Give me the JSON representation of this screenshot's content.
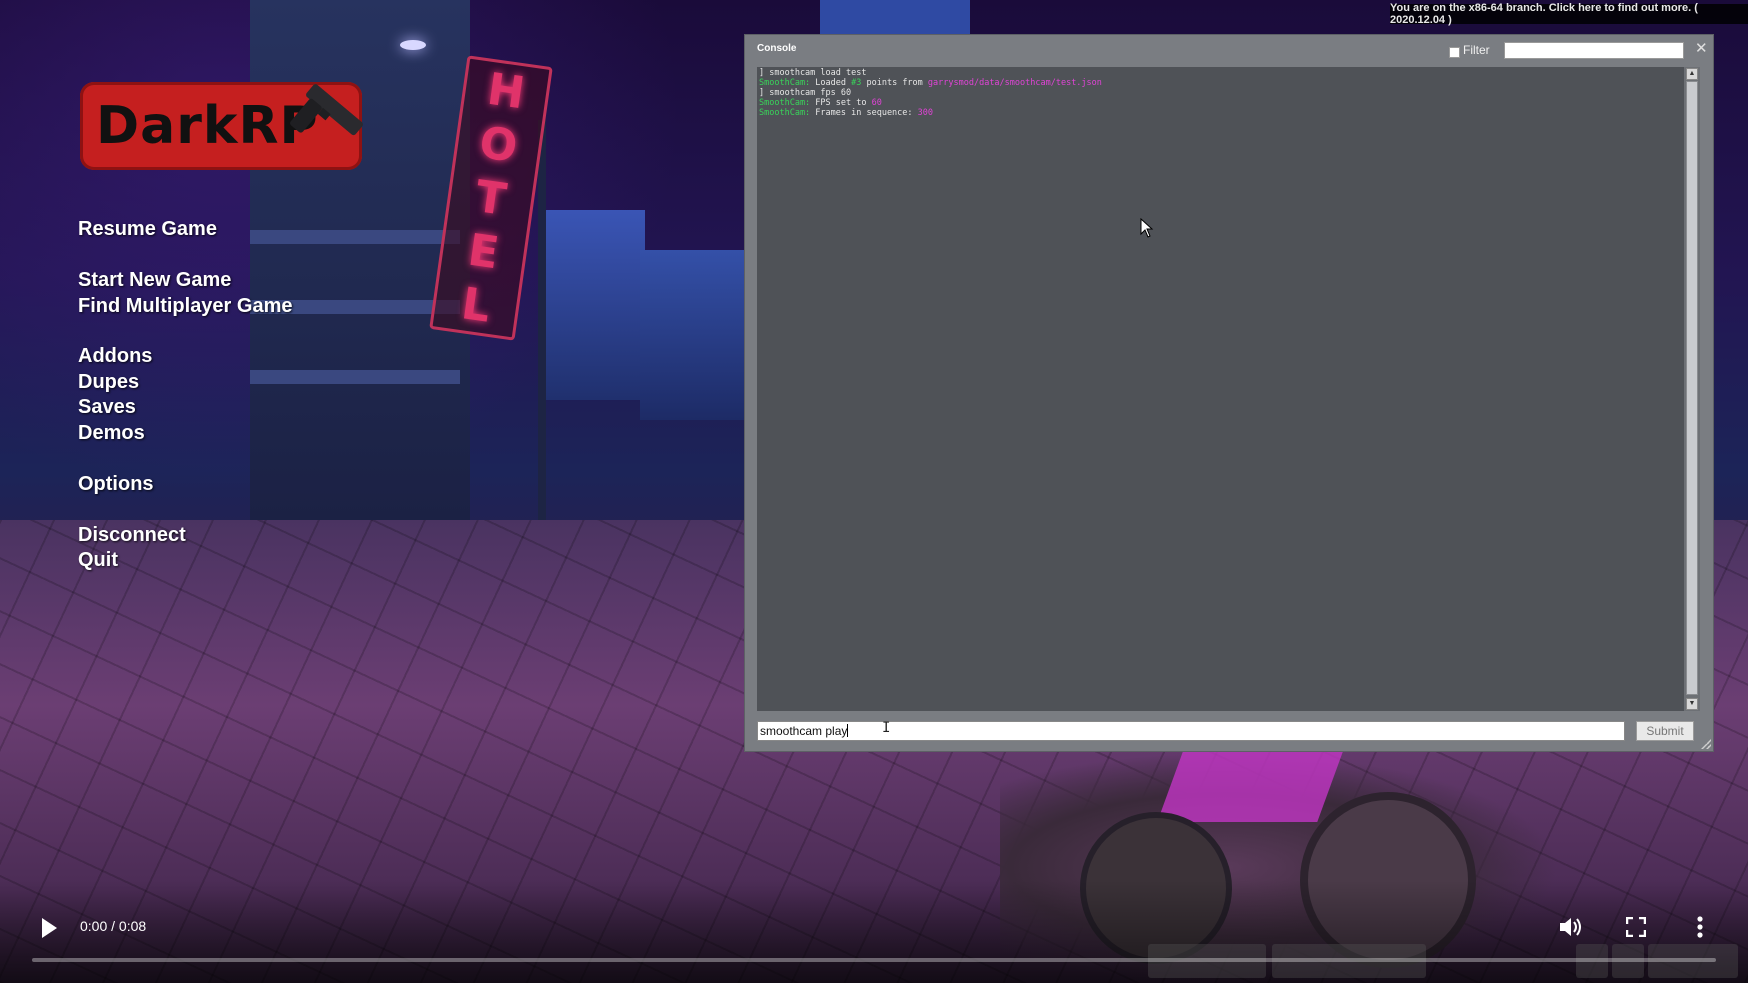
{
  "menu": {
    "logo_text": "DarkRP",
    "items": [
      {
        "label": "Resume Game"
      },
      {
        "label": "Start New Game"
      },
      {
        "label": "Find Multiplayer Game"
      },
      {
        "label": "Addons"
      },
      {
        "label": "Dupes"
      },
      {
        "label": "Saves"
      },
      {
        "label": "Demos"
      },
      {
        "label": "Options"
      },
      {
        "label": "Disconnect"
      },
      {
        "label": "Quit"
      }
    ]
  },
  "banner": {
    "text": "You are on the x86-64 branch. Click here to find out more. ( 2020.12.04 )"
  },
  "console": {
    "title": "Console",
    "filter_label": "Filter",
    "filter_value": "",
    "close_glyph": "✕",
    "input_value": "smoothcam play",
    "submit_label": "Submit",
    "lines": [
      [
        {
          "t": "] smoothcam load test",
          "c": "white"
        }
      ],
      [
        {
          "t": "SmoothCam: ",
          "c": "green"
        },
        {
          "t": "Loaded ",
          "c": "white"
        },
        {
          "t": "#3",
          "c": "green"
        },
        {
          "t": " points from ",
          "c": "white"
        },
        {
          "t": "garrysmod/data/smoothcam/test.json",
          "c": "pink"
        }
      ],
      [
        {
          "t": "] smoothcam fps 60",
          "c": "white"
        }
      ],
      [
        {
          "t": "SmoothCam: ",
          "c": "green"
        },
        {
          "t": "FPS set to ",
          "c": "white"
        },
        {
          "t": "60",
          "c": "pink"
        }
      ],
      [
        {
          "t": "SmoothCam: ",
          "c": "green"
        },
        {
          "t": "Frames in sequence: ",
          "c": "white"
        },
        {
          "t": "300",
          "c": "pink"
        }
      ]
    ]
  },
  "player": {
    "time": "0:00 / 0:08",
    "progress": 0.0
  },
  "icons": {
    "play": "play-icon",
    "volume": "volume-icon",
    "fullscreen": "fullscreen-icon",
    "more": "more-vertical-icon",
    "close": "close-icon",
    "cursor": "mouse-cursor-icon"
  },
  "colors": {
    "console_bg": "#7a7d82",
    "console_output_bg": "#4f5257",
    "log_green": "#39d35a",
    "log_pink": "#e043d6",
    "logo_red": "#c51f1f"
  }
}
